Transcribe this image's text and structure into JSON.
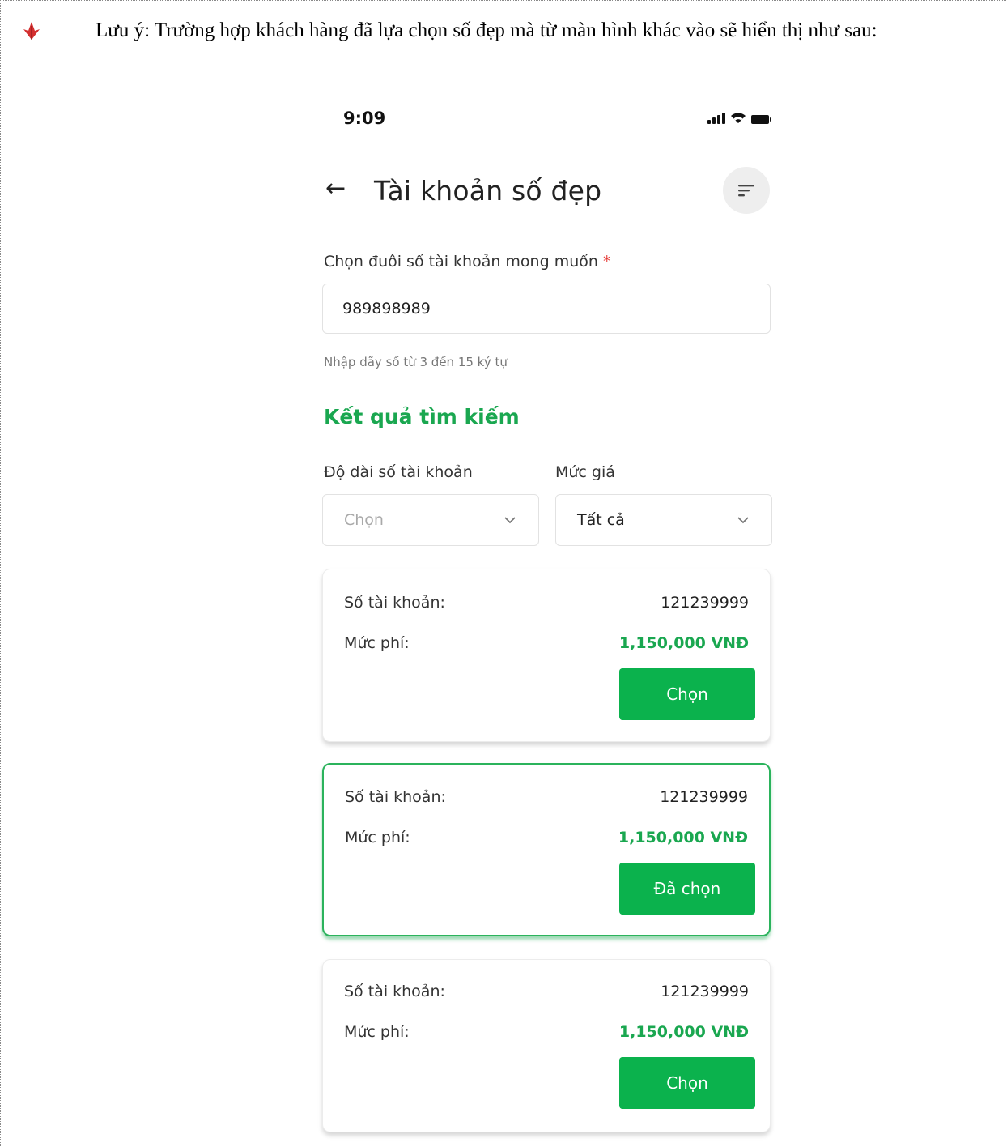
{
  "note": {
    "text": "Lưu ý: Trường hợp khách hàng đã lựa chọn số đẹp mà từ màn hình khác vào sẽ hiển thị như sau:",
    "icon": "red-check-arrow-icon"
  },
  "status_bar": {
    "time": "9:09"
  },
  "header": {
    "title": "Tài khoản số đẹp"
  },
  "form": {
    "label": "Chọn đuôi số tài khoản mong muốn",
    "required_mark": "*",
    "value": "989898989",
    "hint": "Nhập dãy số từ 3 đến 15 ký tự"
  },
  "results": {
    "title": "Kết quả tìm kiếm",
    "filters": [
      {
        "label": "Độ dài số tài khoản",
        "value": "Chọn",
        "is_placeholder": true
      },
      {
        "label": "Mức giá",
        "value": "Tất cả",
        "is_placeholder": false
      }
    ],
    "cards": [
      {
        "account_label": "Số tài khoản:",
        "account": "121239999",
        "fee_label": "Mức phí:",
        "fee": "1,150,000 VNĐ",
        "button": "Chọn",
        "selected": false
      },
      {
        "account_label": "Số tài khoản:",
        "account": "121239999",
        "fee_label": "Mức phí:",
        "fee": "1,150,000 VNĐ",
        "button": "Đã chọn",
        "selected": true
      },
      {
        "account_label": "Số tài khoản:",
        "account": "121239999",
        "fee_label": "Mức phí:",
        "fee": "1,150,000 VNĐ",
        "button": "Chọn",
        "selected": false
      }
    ]
  },
  "colors": {
    "primary_green": "#0bb24d",
    "title_green": "#1aa750",
    "required_red": "#e53935",
    "note_icon_red": "#d32f2f"
  }
}
